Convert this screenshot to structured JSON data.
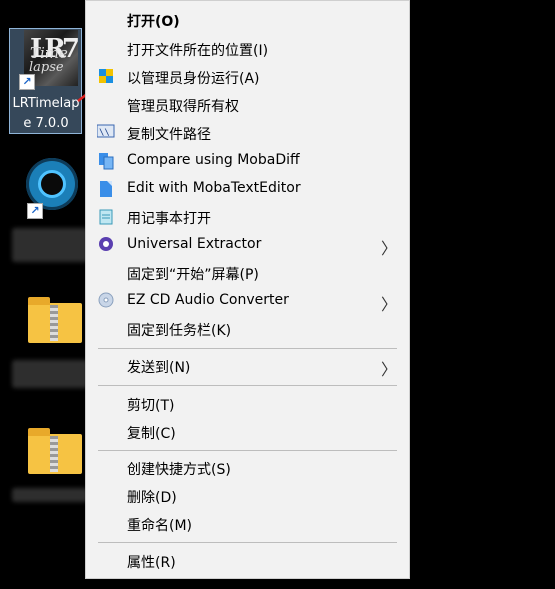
{
  "desktop": {
    "lr_icon": {
      "label_line1": "LRTimelap",
      "label_line2": "e 7.0.0",
      "logo_t1": "Time",
      "logo_t2": "lapse",
      "logo_t3": "LR7"
    }
  },
  "menu": {
    "items": [
      {
        "label": "打开(O)",
        "bold": true,
        "icon": "",
        "submenu": false
      },
      {
        "label": "打开文件所在的位置(I)",
        "icon": "",
        "submenu": false
      },
      {
        "label": "以管理员身份运行(A)",
        "icon": "shield-icon",
        "submenu": false
      },
      {
        "label": "管理员取得所有权",
        "icon": "",
        "submenu": false
      },
      {
        "label": "复制文件路径",
        "icon": "copy-path-icon",
        "submenu": false
      },
      {
        "label": "Compare using MobaDiff",
        "icon": "mobadiff-icon",
        "submenu": false
      },
      {
        "label": "Edit with MobaTextEditor",
        "icon": "mobatexteditor-icon",
        "submenu": false
      },
      {
        "label": "用记事本打开",
        "icon": "notepad-icon",
        "submenu": false
      },
      {
        "label": "Universal Extractor",
        "icon": "universal-extractor-icon",
        "submenu": true
      },
      {
        "label": "固定到“开始”屏幕(P)",
        "icon": "",
        "submenu": false
      },
      {
        "label": "EZ CD Audio Converter",
        "icon": "cd-icon",
        "submenu": true
      },
      {
        "label": "固定到任务栏(K)",
        "icon": "",
        "submenu": false
      },
      {
        "label": "发送到(N)",
        "icon": "",
        "submenu": true
      },
      {
        "label": "剪切(T)",
        "icon": "",
        "submenu": false
      },
      {
        "label": "复制(C)",
        "icon": "",
        "submenu": false
      },
      {
        "label": "创建快捷方式(S)",
        "icon": "",
        "submenu": false
      },
      {
        "label": "删除(D)",
        "icon": "",
        "submenu": false
      },
      {
        "label": "重命名(M)",
        "icon": "",
        "submenu": false
      },
      {
        "label": "属性(R)",
        "icon": "",
        "submenu": false
      }
    ],
    "submenu_glyph": "〉"
  },
  "colors": {
    "menu_bg": "#f2f2f2",
    "desktop_bg": "#000000",
    "arrow": "#e02020",
    "selection": "#8fb4d8"
  }
}
